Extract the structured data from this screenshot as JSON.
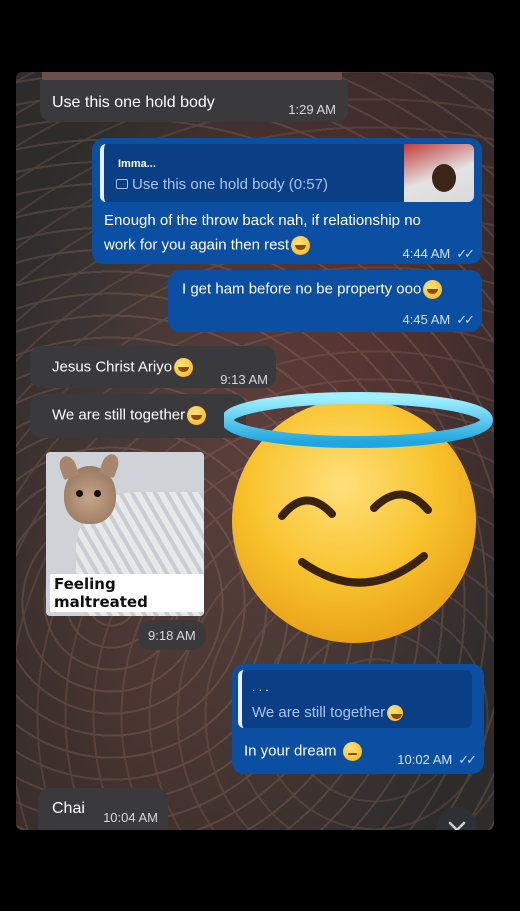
{
  "messages": {
    "m1": {
      "text": "Use this one hold body",
      "time": "1:29 AM"
    },
    "m2": {
      "quote_author": "Imma...",
      "quote_text": "Use this one hold body (0:57)",
      "text_line1": "Enough of the throw back nah, if relationship no",
      "text_line2": "work for you again then rest",
      "time": "4:44 AM"
    },
    "m3": {
      "text": "I get ham before no be property ooo",
      "time": "4:45 AM"
    },
    "m4": {
      "text": "Jesus Christ Ariyo",
      "time": "9:13 AM"
    },
    "m5": {
      "text": "We are still together"
    },
    "m6": {
      "caption": "Feeling maltreated",
      "time": "9:18 AM"
    },
    "m7": {
      "quote_text": "We are still together",
      "text": "In your dream",
      "time": "10:02 AM"
    },
    "m8": {
      "text": "Chai",
      "time": "10:04 AM"
    }
  },
  "ticks": "✓✓",
  "colors": {
    "incoming": "#3a3a3c",
    "outgoing": "#0b4fa3",
    "halo": "#5ad3f5",
    "emoji": "#f5b21a"
  },
  "icons": {
    "scroll": "chevron-down-icon",
    "halo": "smiling-face-with-halo-icon"
  }
}
